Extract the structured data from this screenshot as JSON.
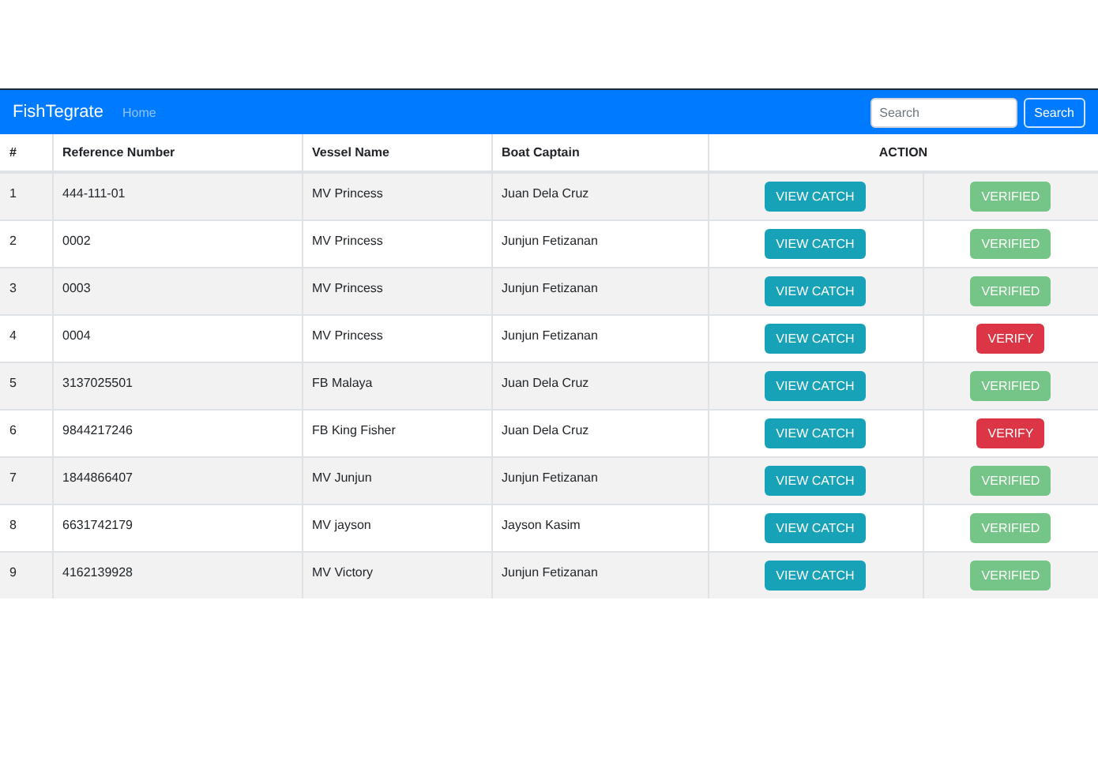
{
  "navbar": {
    "brand": "FishTegrate",
    "links": [
      {
        "label": "Home",
        "selected": false
      }
    ],
    "search": {
      "placeholder": "Search",
      "button": "Search"
    }
  },
  "table": {
    "columns": [
      "#",
      "Reference Number",
      "Vessel Name",
      "Boat Captain",
      "ACTION"
    ],
    "rows": [
      {
        "no": "1",
        "reference": "444-111-01",
        "vessel": "MV Princess",
        "captain": "Juan Dela Cruz",
        "view": "VIEW CATCH",
        "status": "VERIFIED",
        "verified": true
      },
      {
        "no": "2",
        "reference": "0002",
        "vessel": "MV Princess",
        "captain": "Junjun Fetizanan",
        "view": "VIEW CATCH",
        "status": "VERIFIED",
        "verified": true
      },
      {
        "no": "3",
        "reference": "0003",
        "vessel": "MV Princess",
        "captain": "Junjun Fetizanan",
        "view": "VIEW CATCH",
        "status": "VERIFIED",
        "verified": true
      },
      {
        "no": "4",
        "reference": "0004",
        "vessel": "MV Princess",
        "captain": "Junjun Fetizanan",
        "view": "VIEW CATCH",
        "status": "VERIFY",
        "verified": false
      },
      {
        "no": "5",
        "reference": "3137025501",
        "vessel": "FB Malaya",
        "captain": "Juan Dela Cruz",
        "view": "VIEW CATCH",
        "status": "VERIFIED",
        "verified": true
      },
      {
        "no": "6",
        "reference": "9844217246",
        "vessel": "FB King Fisher",
        "captain": "Juan Dela Cruz",
        "view": "VIEW CATCH",
        "status": "VERIFY",
        "verified": false
      },
      {
        "no": "7",
        "reference": "1844866407",
        "vessel": "MV Junjun",
        "captain": "Junjun Fetizanan",
        "view": "VIEW CATCH",
        "status": "VERIFIED",
        "verified": true
      },
      {
        "no": "8",
        "reference": "6631742179",
        "vessel": "MV jayson",
        "captain": "Jayson Kasim",
        "view": "VIEW CATCH",
        "status": "VERIFIED",
        "verified": true
      },
      {
        "no": "9",
        "reference": "4162139928",
        "vessel": "MV Victory",
        "captain": "Junjun Fetizanan",
        "view": "VIEW CATCH",
        "status": "VERIFIED",
        "verified": true
      }
    ]
  }
}
